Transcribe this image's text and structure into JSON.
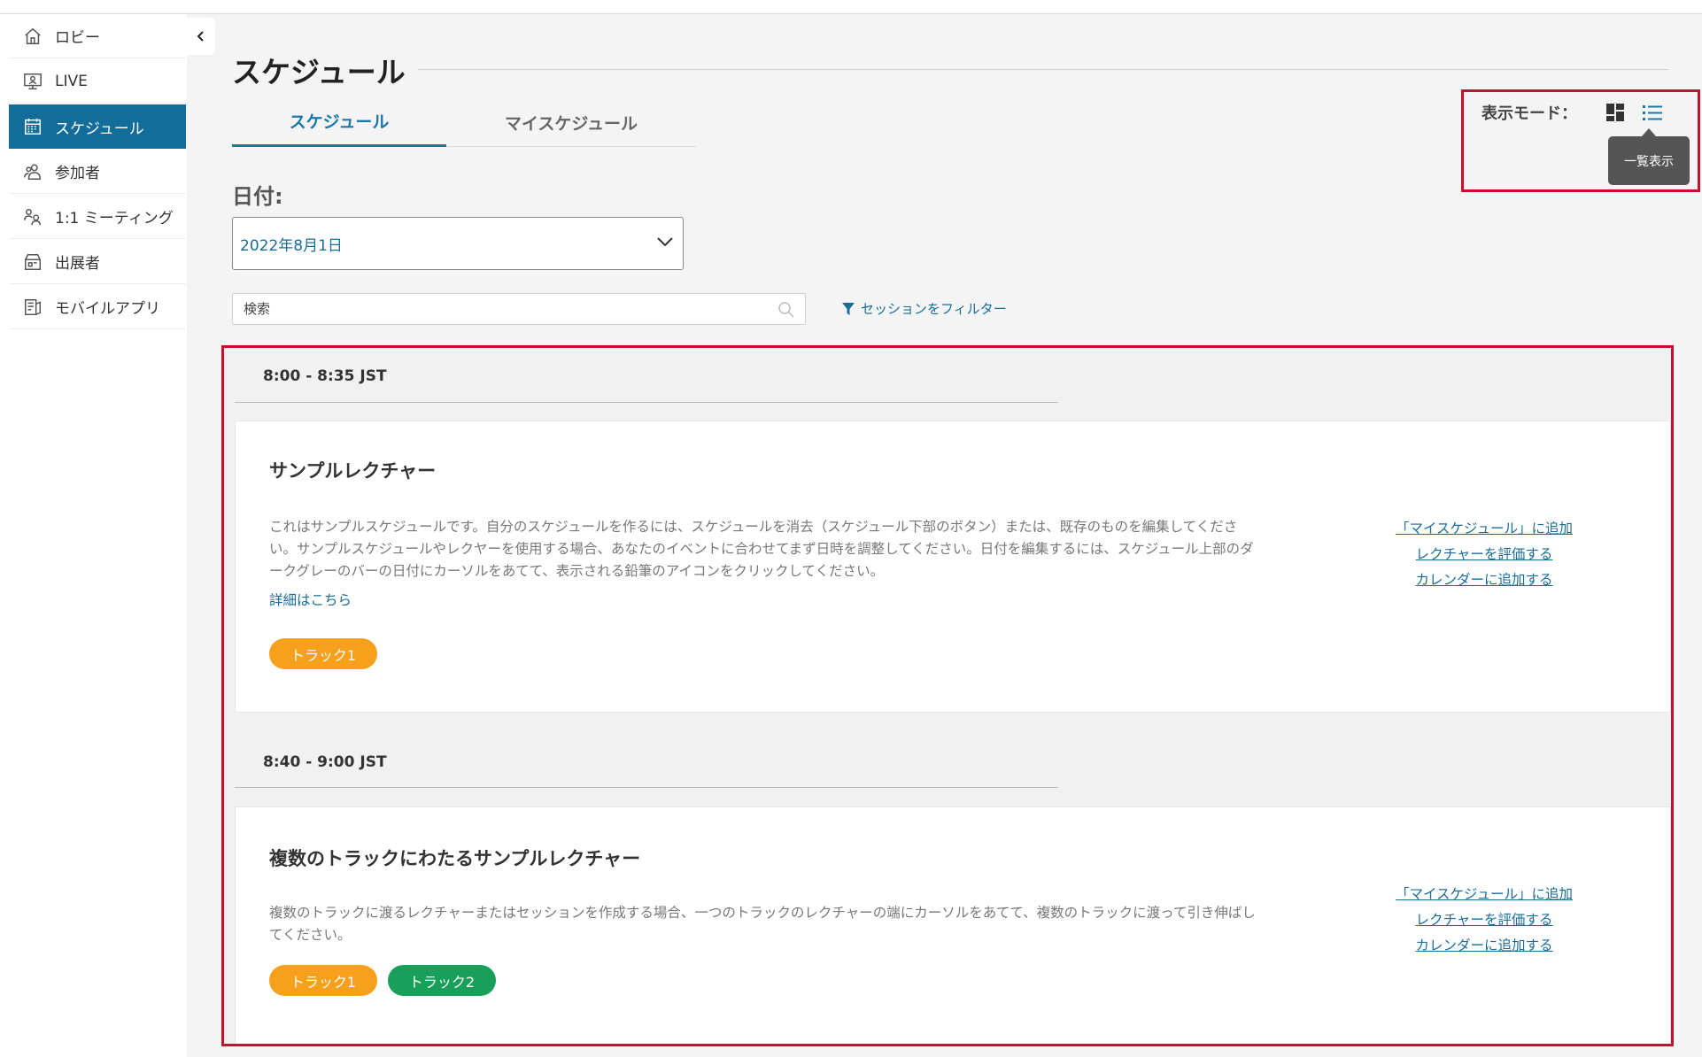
{
  "sidebar": {
    "items": [
      {
        "label": "ロビー",
        "icon": "home-icon"
      },
      {
        "label": "LIVE",
        "icon": "live-monitor-icon"
      },
      {
        "label": "スケジュール",
        "icon": "calendar-icon",
        "active": true
      },
      {
        "label": "参加者",
        "icon": "people-icon"
      },
      {
        "label": "1:1 ミーティング",
        "icon": "meeting-icon"
      },
      {
        "label": "出展者",
        "icon": "exhibitor-booth-icon"
      },
      {
        "label": "モバイルアプリ",
        "icon": "mobile-app-icon"
      }
    ]
  },
  "page": {
    "title": "スケジュール"
  },
  "tabs": [
    {
      "label": "スケジュール",
      "active": true
    },
    {
      "label": "マイスケジュール",
      "active": false
    }
  ],
  "date": {
    "label": "日付:",
    "selected": "2022年8月1日"
  },
  "search": {
    "placeholder": "検索"
  },
  "filter": {
    "label": "セッションをフィルター"
  },
  "view_mode": {
    "label": "表示モード：",
    "tooltip": "一覧表示",
    "active": "list"
  },
  "sessions": [
    {
      "time": "8:00 - 8:35 JST",
      "title": "サンプルレクチャー",
      "description": "これはサンプルスケジュールです。自分のスケジュールを作るには、スケジュールを消去（スケジュール下部のボタン）または、既存のものを編集してください。サンプルスケジュールやレクヤーを使用する場合、あなたのイベントに合わせてまず日時を調整してください。日付を編集するには、スケジュール上部のダークグレーのバーの日付にカーソルをあてて、表示される鉛筆のアイコンをクリックしてください。",
      "detail_link": "詳細はこちら",
      "tags": [
        {
          "label": "トラック1",
          "color": "#f7a01c"
        }
      ],
      "actions": [
        "「マイスケジュール」に追加",
        "レクチャーを評価する",
        "カレンダーに追加する"
      ]
    },
    {
      "time": "8:40 - 9:00 JST",
      "title": "複数のトラックにわたるサンプルレクチャー",
      "description": "複数のトラックに渡るレクチャーまたはセッションを作成する場合、一つのトラックのレクチャーの端にカーソルをあてて、複数のトラックに渡って引き伸ばしてください。",
      "tags": [
        {
          "label": "トラック1",
          "color": "#f7a01c"
        },
        {
          "label": "トラック2",
          "color": "#18a05a"
        }
      ],
      "actions": [
        "「マイスケジュール」に追加",
        "レクチャーを評価する",
        "カレンダーに追加する"
      ]
    }
  ],
  "colors": {
    "accent": "#136d9a",
    "link": "#1a6d99",
    "highlight_border": "#c8102e"
  }
}
